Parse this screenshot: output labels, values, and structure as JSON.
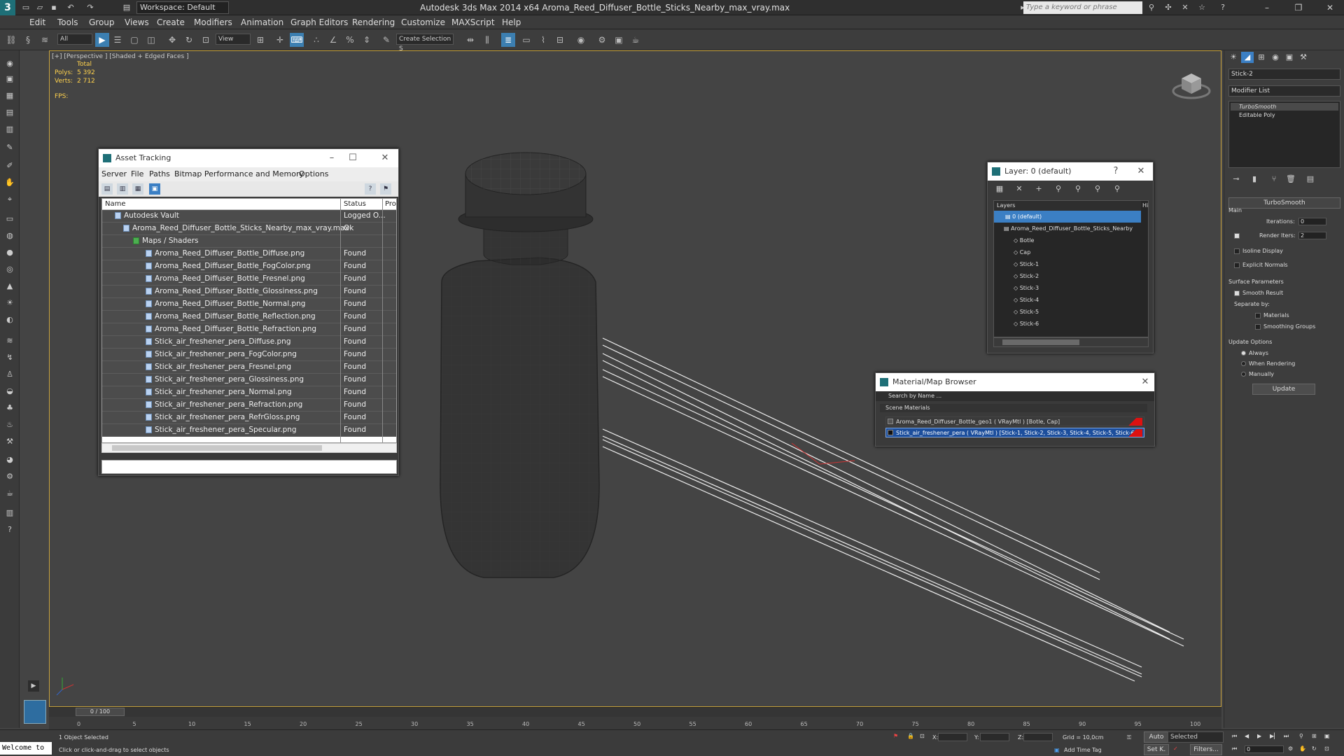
{
  "app": {
    "logo": "3",
    "title": "Autodesk 3ds Max  2014 x64     Aroma_Reed_Diffuser_Bottle_Sticks_Nearby_max_vray.max",
    "workspace": "Workspace: Default",
    "search_placeholder": "Type a keyword or phrase"
  },
  "menu": [
    "Edit",
    "Tools",
    "Group",
    "Views",
    "Create",
    "Modifiers",
    "Animation",
    "Graph Editors",
    "Rendering",
    "Customize",
    "MAXScript",
    "Help"
  ],
  "toolbar": {
    "filter": "All",
    "view": "View",
    "selection_set": "Create Selection S"
  },
  "viewport": {
    "label": "[+] [Perspective ] [Shaded + Edged Faces ]",
    "stats_total": "Total",
    "polys_label": "Polys:",
    "polys": "5 392",
    "verts_label": "Verts:",
    "verts": "2 712",
    "fps_label": "FPS:"
  },
  "command_panel": {
    "object_name": "Stick-2",
    "modifier_list": "Modifier List",
    "stack": [
      "TurboSmooth",
      "Editable Poly"
    ],
    "rollout_title": "TurboSmooth",
    "main": "Main",
    "iterations_label": "Iterations:",
    "iterations": "0",
    "render_iters_label": "Render Iters:",
    "render_iters": "2",
    "isoline": "Isoline Display",
    "explicit": "Explicit Normals",
    "surface_params": "Surface Parameters",
    "smooth_result": "Smooth Result",
    "separate_by": "Separate by:",
    "materials": "Materials",
    "smoothing_groups": "Smoothing Groups",
    "update_options": "Update Options",
    "always": "Always",
    "when_rendering": "When Rendering",
    "manually": "Manually",
    "update_btn": "Update"
  },
  "asset_tracking": {
    "title": "Asset Tracking",
    "menu": [
      "Server",
      "File",
      "Paths",
      "Bitmap Performance and Memory",
      "Options"
    ],
    "columns": [
      "Name",
      "Status",
      "Pro"
    ],
    "rows": [
      {
        "name": "Autodesk Vault",
        "status": "Logged O..."
      },
      {
        "name": "Aroma_Reed_Diffuser_Bottle_Sticks_Nearby_max_vray.max",
        "status": "Ok"
      },
      {
        "name": "Maps / Shaders",
        "status": ""
      },
      {
        "name": "Aroma_Reed_Diffuser_Bottle_Diffuse.png",
        "status": "Found"
      },
      {
        "name": "Aroma_Reed_Diffuser_Bottle_FogColor.png",
        "status": "Found"
      },
      {
        "name": "Aroma_Reed_Diffuser_Bottle_Fresnel.png",
        "status": "Found"
      },
      {
        "name": "Aroma_Reed_Diffuser_Bottle_Glossiness.png",
        "status": "Found"
      },
      {
        "name": "Aroma_Reed_Diffuser_Bottle_Normal.png",
        "status": "Found"
      },
      {
        "name": "Aroma_Reed_Diffuser_Bottle_Reflection.png",
        "status": "Found"
      },
      {
        "name": "Aroma_Reed_Diffuser_Bottle_Refraction.png",
        "status": "Found"
      },
      {
        "name": "Stick_air_freshener_pera_Diffuse.png",
        "status": "Found"
      },
      {
        "name": "Stick_air_freshener_pera_FogColor.png",
        "status": "Found"
      },
      {
        "name": "Stick_air_freshener_pera_Fresnel.png",
        "status": "Found"
      },
      {
        "name": "Stick_air_freshener_pera_Glossiness.png",
        "status": "Found"
      },
      {
        "name": "Stick_air_freshener_pera_Normal.png",
        "status": "Found"
      },
      {
        "name": "Stick_air_freshener_pera_Refraction.png",
        "status": "Found"
      },
      {
        "name": "Stick_air_freshener_pera_RefrGloss.png",
        "status": "Found"
      },
      {
        "name": "Stick_air_freshener_pera_Specular.png",
        "status": "Found"
      }
    ]
  },
  "layer_dialog": {
    "title": "Layer: 0 (default)",
    "col_layers": "Layers",
    "col_hide": "Hi",
    "rows": [
      "0 (default)",
      "Aroma_Reed_Diffuser_Bottle_Sticks_Nearby",
      "Botle",
      "Cap",
      "Stick-1",
      "Stick-2",
      "Stick-3",
      "Stick-4",
      "Stick-5",
      "Stick-6"
    ]
  },
  "material_browser": {
    "title": "Material/Map Browser",
    "search": "Search by Name ...",
    "section": "Scene Materials",
    "rows": [
      "Aroma_Reed_Diffuser_Bottle_geo1  ( VRayMtl ) [Botle, Cap]",
      "Stick_air_freshener_pera  ( VRayMtl ) [Stick-1, Stick-2, Stick-3, Stick-4, Stick-5, Stick-6]"
    ]
  },
  "timeline": {
    "frame": "0 / 100",
    "ticks": [
      "0",
      "5",
      "10",
      "15",
      "20",
      "25",
      "30",
      "35",
      "40",
      "45",
      "50",
      "55",
      "60",
      "65",
      "70",
      "75",
      "80",
      "85",
      "90",
      "95",
      "100"
    ]
  },
  "status": {
    "maxscript": "Welcome to",
    "selected": "1 Object Selected",
    "prompt": "Click or click-and-drag to select objects",
    "x_label": "X:",
    "y_label": "Y:",
    "z_label": "Z:",
    "grid": "Grid = 10,0cm",
    "add_time_tag": "Add Time Tag",
    "auto": "Auto",
    "set_key": "Set K.",
    "selected_drop": "Selected",
    "filters": "Filters...",
    "frame_field": "0"
  },
  "colors": {
    "accent": "#3b7fc4",
    "viewport_border": "#c7a23d",
    "stats": "#ffd24d"
  }
}
